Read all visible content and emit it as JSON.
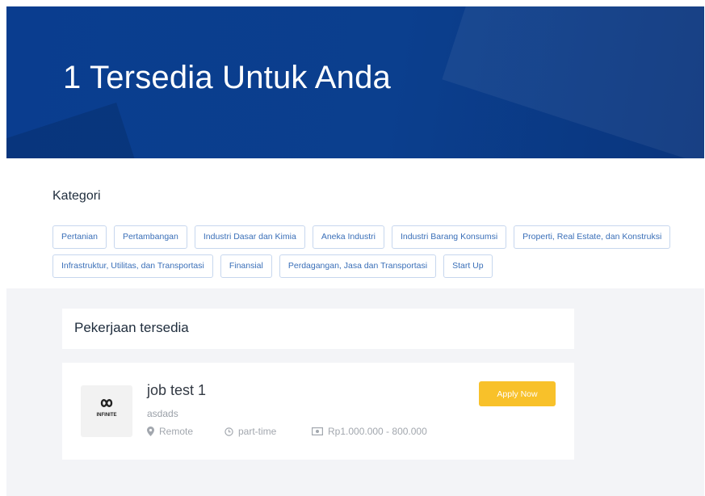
{
  "hero": {
    "title": "1 Tersedia Untuk Anda"
  },
  "kategori": {
    "title": "Kategori",
    "rows": [
      [
        "Pertanian",
        "Pertambangan",
        "Industri Dasar dan Kimia",
        "Aneka Industri",
        "Industri Barang Konsumsi",
        "Properti, Real Estate, dan Konstruksi"
      ],
      [
        "Infrastruktur, Utilitas, dan Transportasi",
        "Finansial",
        "Perdagangan, Jasa dan Transportasi",
        "Start Up"
      ]
    ]
  },
  "jobs_panel": {
    "title": "Pekerjaan tersedia"
  },
  "job": {
    "logo_text": "INFINITE",
    "title": "job test 1",
    "company": "asdads",
    "location": "Remote",
    "type": "part-time",
    "salary": "Rp1.000.000 - 800.000",
    "apply_label": "Apply Now"
  },
  "colors": {
    "hero_bg": "#0a3d8f",
    "chip_text": "#3a6fb8",
    "apply_button": "#f8c12a",
    "section_bg": "#f3f4f7"
  },
  "icons": {
    "location": "map-pin-icon",
    "type": "clock-icon",
    "salary": "money-icon"
  }
}
